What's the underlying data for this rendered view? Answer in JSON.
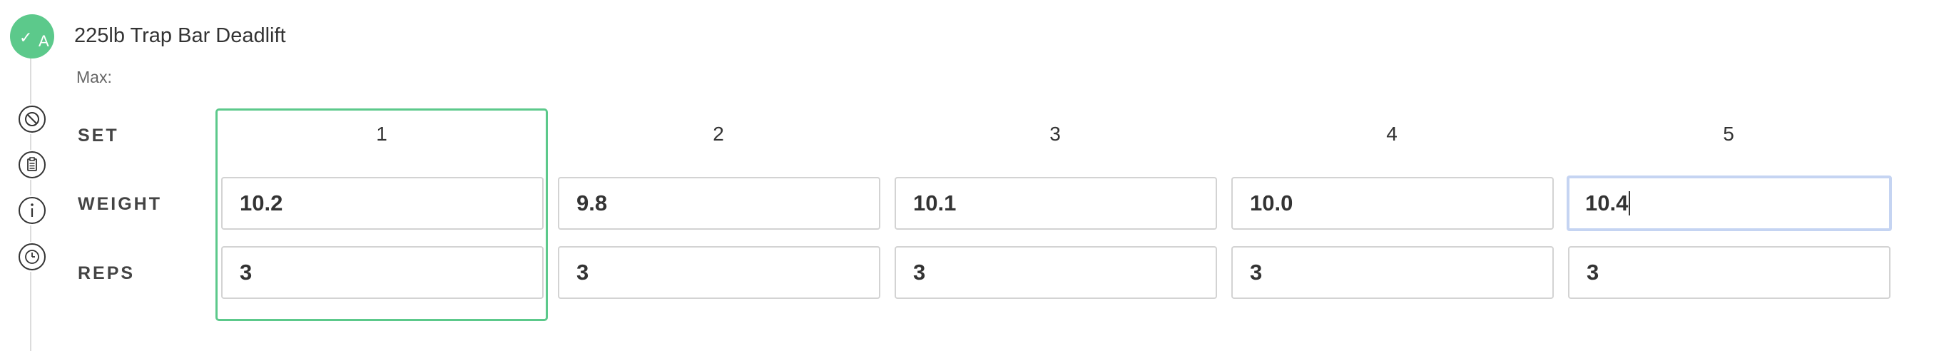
{
  "exercise": {
    "title": "225lb Trap Bar Deadlift",
    "max_label": "Max:",
    "avatar_letter": "A"
  },
  "side_icons": [
    "block-icon",
    "clipboard-icon",
    "info-icon",
    "clock-icon"
  ],
  "rows": {
    "set_label": "SET",
    "weight_label": "WEIGHT",
    "reps_label": "REPS"
  },
  "sets": [
    {
      "number": "1",
      "weight": "10.2",
      "reps": "3"
    },
    {
      "number": "2",
      "weight": "9.8",
      "reps": "3"
    },
    {
      "number": "3",
      "weight": "10.1",
      "reps": "3"
    },
    {
      "number": "4",
      "weight": "10.0",
      "reps": "3"
    },
    {
      "number": "5",
      "weight": "10.4",
      "reps": "3"
    }
  ],
  "colors": {
    "accent_green": "#5cc98b",
    "focus_blue": "#c5d4f2",
    "border_gray": "#d3d3d3"
  }
}
